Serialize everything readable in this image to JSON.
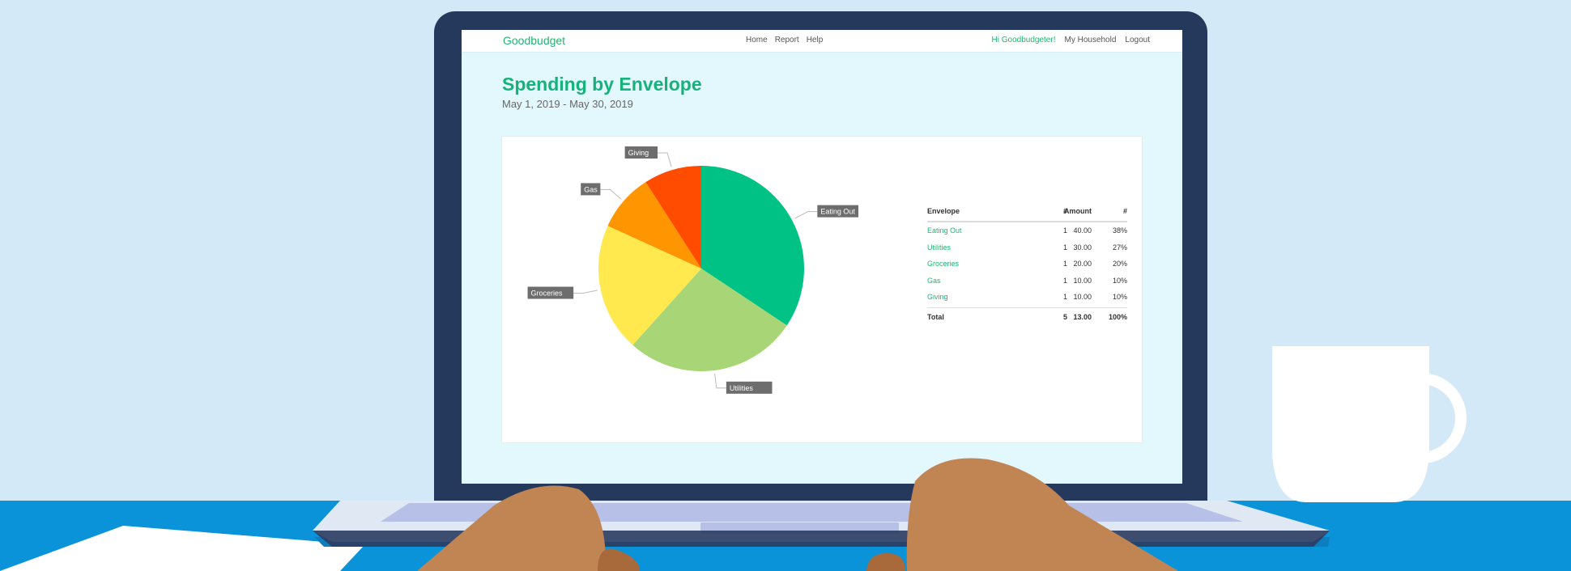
{
  "nav": {
    "brand": "Goodbudget",
    "center": [
      "Home",
      "Report",
      "Help"
    ],
    "right": [
      "Hi Goodbudgeter!",
      "My Household",
      "Logout"
    ]
  },
  "page": {
    "title": "Spending by Envelope",
    "subtitle": "May 1, 2019 - May 30, 2019"
  },
  "table": {
    "headers": [
      "Envelope",
      "#",
      "Amount",
      "#"
    ],
    "rows": [
      {
        "envelope": "Eating Out",
        "count": "1",
        "amount": "40.00",
        "pct": "38%"
      },
      {
        "envelope": "Utilities",
        "count": "1",
        "amount": "30.00",
        "pct": "27%"
      },
      {
        "envelope": "Groceries",
        "count": "1",
        "amount": "20.00",
        "pct": "20%"
      },
      {
        "envelope": "Gas",
        "count": "1",
        "amount": "10.00",
        "pct": "10%"
      },
      {
        "envelope": "Giving",
        "count": "1",
        "amount": "10.00",
        "pct": "10%"
      }
    ],
    "total": {
      "label": "Total",
      "count": "5",
      "amount": "13.00",
      "pct": "100%"
    }
  },
  "chart_data": {
    "type": "pie",
    "categories": [
      "Eating Out",
      "Utilities",
      "Groceries",
      "Gas",
      "Giving"
    ],
    "values": [
      34,
      27,
      20,
      9,
      9
    ],
    "colors": [
      "#00c285",
      "#a8d676",
      "#ffe94f",
      "#ff9500",
      "#ff4c00"
    ]
  }
}
